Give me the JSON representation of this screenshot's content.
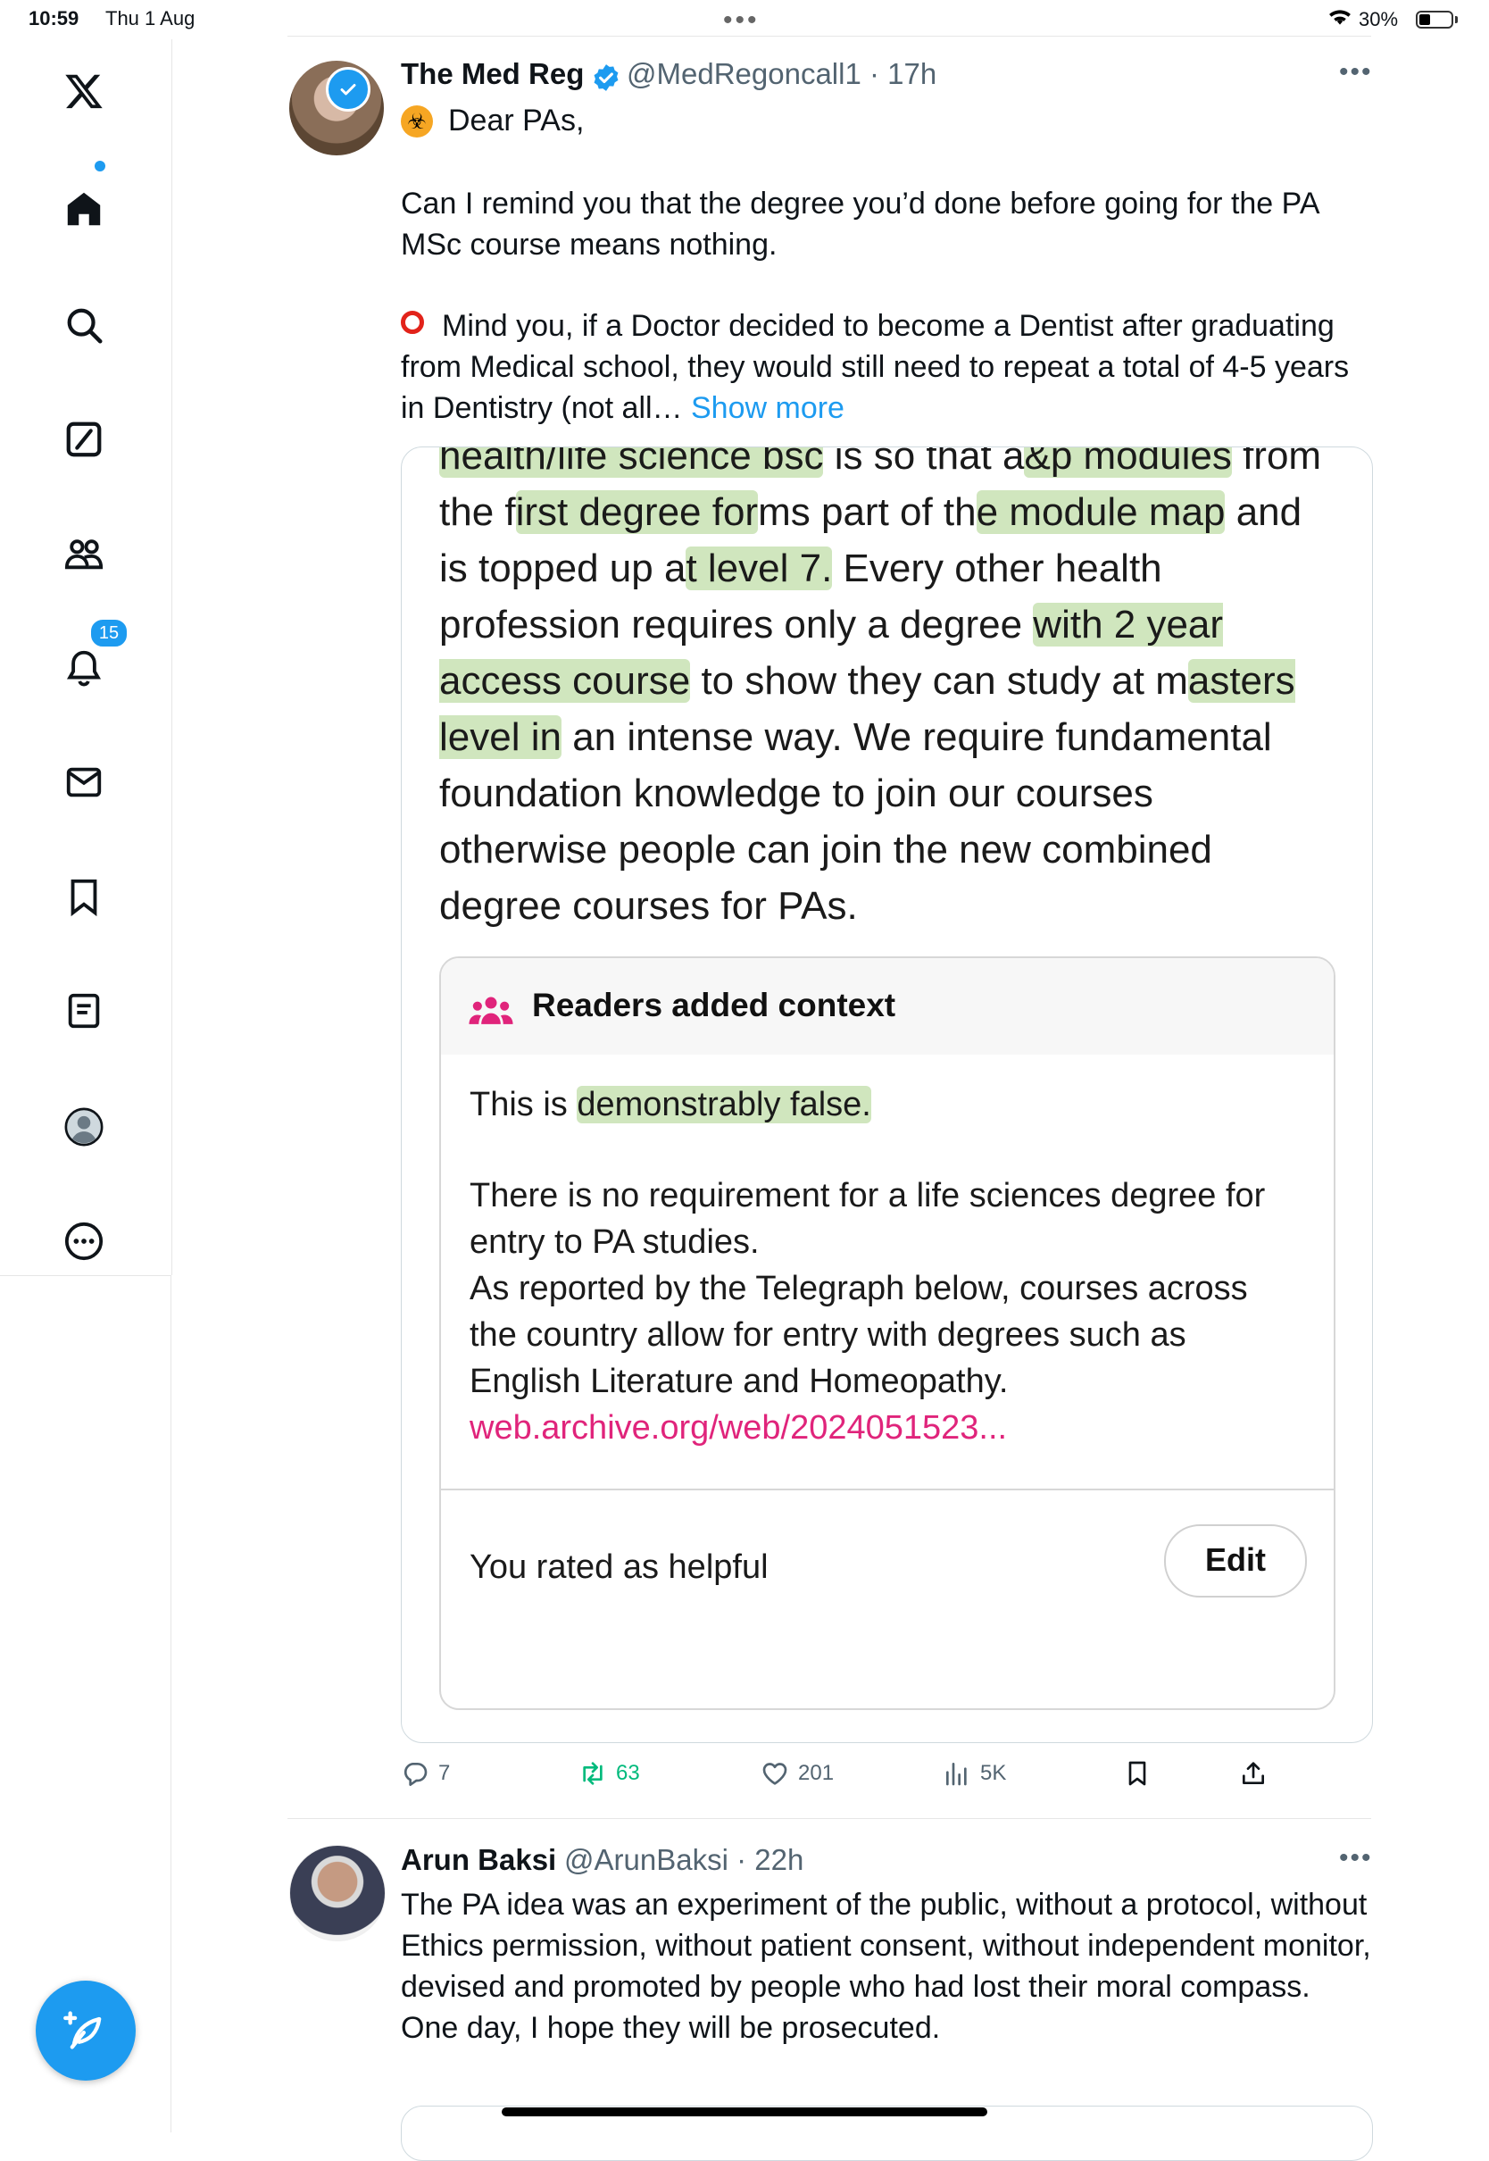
{
  "status_bar": {
    "time": "10:59",
    "date": "Thu 1 Aug",
    "battery": "30%",
    "battery_level": 0.3
  },
  "nav": {
    "items": [
      {
        "name": "x-logo",
        "icon": "x-logo-icon"
      },
      {
        "name": "home",
        "icon": "home-icon"
      },
      {
        "name": "explore",
        "icon": "search-icon"
      },
      {
        "name": "grok",
        "icon": "grok-icon"
      },
      {
        "name": "communities",
        "icon": "people-icon"
      },
      {
        "name": "notifications",
        "icon": "bell-icon"
      },
      {
        "name": "messages",
        "icon": "mail-icon"
      },
      {
        "name": "bookmarks",
        "icon": "bookmark-icon"
      },
      {
        "name": "lists",
        "icon": "list-icon"
      },
      {
        "name": "profile",
        "icon": "avatar-icon"
      },
      {
        "name": "more",
        "icon": "more-icon"
      }
    ],
    "notification_count": "15",
    "compose_icon": "compose-icon"
  },
  "tweet1": {
    "name": "The Med Reg",
    "handle": "@MedRegoncall1",
    "time": "17h",
    "greeting": "Dear PAs,",
    "para1": "Can I remind you that the degree you’d done before going for the PA MSc course means nothing.",
    "para2": "Mind you, if a Doctor decided to become a Dentist after graduating from Medical school, they would still need to repeat a total of 4-5 years in Dentistry (not all…",
    "show_more": "Show more",
    "media_text": [
      {
        "t": "health/life science bsc",
        "hl": true
      },
      {
        "t": " is so that a",
        "hl": false
      },
      {
        "t": "&p modules",
        "hl": true
      },
      {
        "t": " from the f",
        "hl": false
      },
      {
        "t": "irst degree for",
        "hl": true
      },
      {
        "t": "ms part of th",
        "hl": false
      },
      {
        "t": "e module map",
        "hl": true
      },
      {
        "t": " and is topped up a",
        "hl": false
      },
      {
        "t": "t level 7.",
        "hl": true
      },
      {
        "t": " Every other health profession requires only a degree ",
        "hl": false
      },
      {
        "t": "with 2 year access course",
        "hl": true
      },
      {
        "t": " to show they can study at m",
        "hl": false
      },
      {
        "t": "asters level in",
        "hl": true
      },
      {
        "t": " an intense way. We require fundamental foundation knowledge to join our courses otherwise people can join the new combined degree courses for PAs.",
        "hl": false
      }
    ],
    "context": {
      "title": "Readers added context",
      "p1_prefix": "This is ",
      "p1_highlight": "demonstrably false.",
      "p2": "There is no requirement for a life sciences degree for entry to PA studies.",
      "p3": "As reported by the Telegraph below, courses across the country allow for entry with degrees such as English Literature and Homeopathy.",
      "link": "web.archive.org/web/2024051523...",
      "rated": "You rated as helpful",
      "edit": "Edit"
    },
    "stats": {
      "replies": "7",
      "retweets": "63",
      "likes": "201",
      "views": "5K"
    }
  },
  "tweet2": {
    "name": "Arun Baksi",
    "handle": "@ArunBaksi",
    "time": "22h",
    "body": "The PA idea was an experiment of the public, without a protocol, without Ethics permission, without patient consent, without independent monitor, devised and promoted by people who had lost their moral compass.\nOne day, I hope they will be prosecuted."
  },
  "colors": {
    "accent": "#1d9bf0",
    "retweet_green": "#00ba7c",
    "highlight": "#96c86e",
    "link_pink": "#e0247b",
    "alert_red": "#e2231a"
  }
}
